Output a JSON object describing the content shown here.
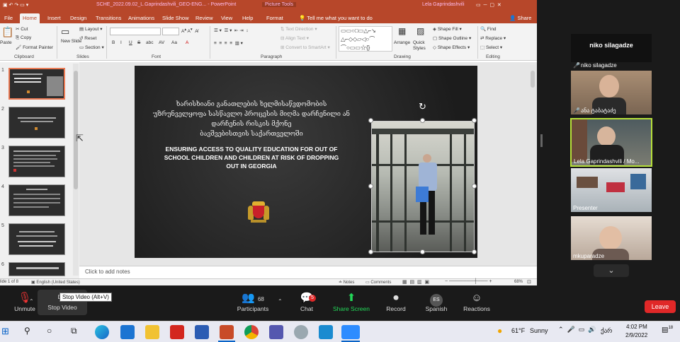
{
  "ppt": {
    "file_title": "SCHE_2022.09.02_L.Gaprindashvili_GEO-ENG...  -  PowerPoint",
    "picture_tools": "Picture Tools",
    "user": "Lela Gaprindashvili",
    "tabs": [
      "File",
      "Home",
      "Insert",
      "Design",
      "Transitions",
      "Animations",
      "Slide Show",
      "Review",
      "View",
      "Help",
      "Format"
    ],
    "tell_me": "Tell me what you want to do",
    "share": "Share",
    "clipboard": {
      "paste": "Paste",
      "cut": "Cut",
      "copy": "Copy",
      "format_painter": "Format Painter",
      "group": "Clipboard"
    },
    "slides": {
      "new_slide": "New Slide",
      "layout": "Layout",
      "reset": "Reset",
      "section": "Section",
      "group": "Slides"
    },
    "font": {
      "group": "Font",
      "buttons": [
        "B",
        "I",
        "U",
        "S",
        "abc",
        "AV",
        "Aa",
        "A"
      ]
    },
    "paragraph": {
      "group": "Paragraph",
      "text_direction": "Text Direction",
      "align_text": "Align Text",
      "convert_smartart": "Convert to SmartArt"
    },
    "drawing": {
      "arrange": "Arrange",
      "quick_styles": "Quick Styles",
      "shape_fill": "Shape Fill",
      "shape_outline": "Shape Outline",
      "shape_effects": "Shape Effects",
      "group": "Drawing"
    },
    "editing": {
      "find": "Find",
      "replace": "Replace",
      "select": "Select",
      "group": "Editing"
    },
    "slide_numbers": [
      "1",
      "2",
      "3",
      "4",
      "5",
      "6"
    ],
    "slide": {
      "georgian_lines": [
        "ხარისხიანი განათლების ხელმისაწვდომობის",
        "უზრუნველყოფა სასწავლო პროცესის მიღმა დარჩენილი ან",
        "დარჩენის რისკის მქონე",
        "ბავშვებისთვის საქართველოში"
      ],
      "english_lines": [
        "ENSURING ACCESS TO QUALITY EDUCATION FOR OUT OF",
        "SCHOOL CHILDREN AND CHILDREN AT RISK OF DROPPING",
        "OUT IN GEORGIA"
      ]
    },
    "notes_placeholder": "Click to add notes",
    "status": {
      "slide_of": "lide 1 of 8",
      "language": "English (United States)",
      "notes": "Notes",
      "comments": "Comments",
      "zoom": "68%"
    }
  },
  "zoom": {
    "active_speaker": "niko silagadze",
    "participants": [
      {
        "name": "niko silagadze"
      },
      {
        "name": "ანა ტაბატაძე"
      },
      {
        "name": "Lela Gaprindashvili / Mo..."
      },
      {
        "name": "Presenter"
      },
      {
        "name": "mkuparadze"
      }
    ],
    "tooltip": "Stop Video (Alt+V)",
    "controls": {
      "unmute": "Unmute",
      "stop_video": "Stop Video",
      "participants": "Participants",
      "participants_count": "68",
      "chat": "Chat",
      "chat_badge": "5",
      "share_screen": "Share Screen",
      "record": "Record",
      "spanish": "Spanish",
      "spanish_badge": "ES",
      "reactions": "Reactions",
      "leave": "Leave"
    }
  },
  "taskbar": {
    "weather_temp": "61°F",
    "weather_text": "Sunny",
    "lang": "ქარ",
    "time": "4:02 PM",
    "date": "2/9/2022",
    "notif": "18"
  },
  "colors": {
    "ppt_accent": "#b7472a",
    "zoom_green": "#23d959",
    "leave_red": "#e02828",
    "active_border": "#b6e03a"
  }
}
